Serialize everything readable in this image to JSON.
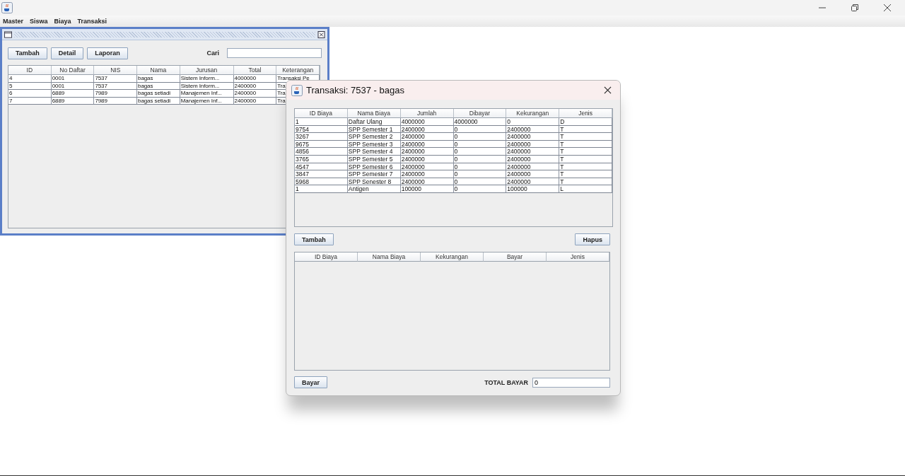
{
  "menu": [
    "Master",
    "Siswa",
    "Biaya",
    "Transaksi"
  ],
  "frame": {
    "buttons": [
      "Tambah",
      "Detail",
      "Laporan"
    ],
    "search": {
      "label": "Cari"
    },
    "table": {
      "columns": [
        "ID",
        "No Daftar",
        "NIS",
        "Nama",
        "Jurusan",
        "Total",
        "Keterangan"
      ],
      "rows": [
        [
          "4",
          "0001",
          "7537",
          "bagas",
          "Sistem Inform...",
          "4000000",
          "Transaksi Pe"
        ],
        [
          "5",
          "0001",
          "7537",
          "bagas",
          "Sistem Inform...",
          "2400000",
          "Tra"
        ],
        [
          "6",
          "6889",
          "7989",
          "bagas setiadi",
          "Manajemen Inf...",
          "2400000",
          "Tra"
        ],
        [
          "7",
          "6889",
          "7989",
          "bagas setiadi",
          "Manajemen Inf...",
          "2400000",
          "Tra"
        ]
      ]
    }
  },
  "dialog": {
    "title": "Transaksi: 7537 - bagas",
    "fees": {
      "columns": [
        "ID Biaya",
        "Nama Biaya",
        "Jumlah",
        "Dibayar",
        "Kekurangan",
        "Jenis"
      ],
      "rows": [
        [
          "1",
          "Daftar Ulang",
          "4000000",
          "4000000",
          "0",
          "D"
        ],
        [
          "9754",
          "SPP Semester 1",
          "2400000",
          "0",
          "2400000",
          "T"
        ],
        [
          "3267",
          "SPP Semester 2",
          "2400000",
          "0",
          "2400000",
          "T"
        ],
        [
          "9675",
          "SPP Semester 3",
          "2400000",
          "0",
          "2400000",
          "T"
        ],
        [
          "4856",
          "SPP Semester 4",
          "2400000",
          "0",
          "2400000",
          "T"
        ],
        [
          "3765",
          "SPP Semester 5",
          "2400000",
          "0",
          "2400000",
          "T"
        ],
        [
          "4547",
          "SPP Semester 6",
          "2400000",
          "0",
          "2400000",
          "T"
        ],
        [
          "3847",
          "SPP Semester 7",
          "2400000",
          "0",
          "2400000",
          "T"
        ],
        [
          "5968",
          "SPP Senester 8",
          "2400000",
          "0",
          "2400000",
          "T"
        ],
        [
          "1",
          "Antigen",
          "100000",
          "0",
          "100000",
          "L"
        ]
      ]
    },
    "add_button": "Tambah",
    "delete_button": "Hapus",
    "payments": {
      "columns": [
        "ID Biaya",
        "Nama Biaya",
        "Kekurangan",
        "Bayar",
        "Jenis"
      ]
    },
    "pay_button": "Bayar",
    "total_label": "TOTAL BAYAR",
    "total_value": "0"
  }
}
